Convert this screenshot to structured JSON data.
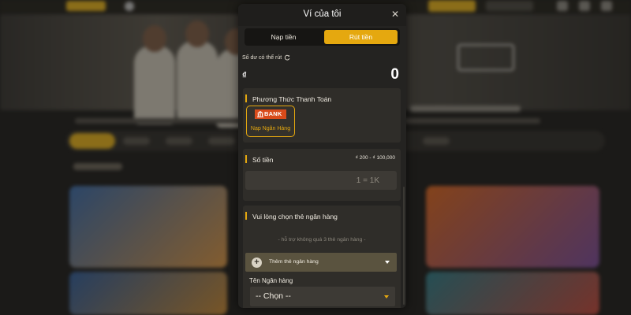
{
  "modal": {
    "title": "Ví của tôi",
    "close_icon": "close-icon",
    "tabs": [
      {
        "label": "Nạp tiền",
        "active": false
      },
      {
        "label": "Rút tiền",
        "active": true
      }
    ],
    "balance": {
      "label": "Số dư có thể rút",
      "currency_symbol": "₫",
      "value": "0"
    },
    "payment_method": {
      "title": "Phương Thức Thanh Toán",
      "options": [
        {
          "logo_text": "BANK",
          "label": "Nạp Ngân Hàng",
          "selected": true
        }
      ]
    },
    "amount": {
      "title": "Số tiền",
      "range": "₫ 200 - ₫ 100,000",
      "placeholder": "1 = 1K"
    },
    "bank_card": {
      "title": "Vui lòng chọn thẻ ngân hàng",
      "note": "- hỗ trợ không quá 3 thẻ ngân hàng -",
      "add_label": "Thêm thẻ ngân hàng",
      "bank_name_label": "Tên Ngân hàng",
      "select_value": "-- Chọn --"
    }
  },
  "colors": {
    "accent": "#e5a80f",
    "modal_bg": "#242321",
    "section_bg": "#2f2d29"
  }
}
